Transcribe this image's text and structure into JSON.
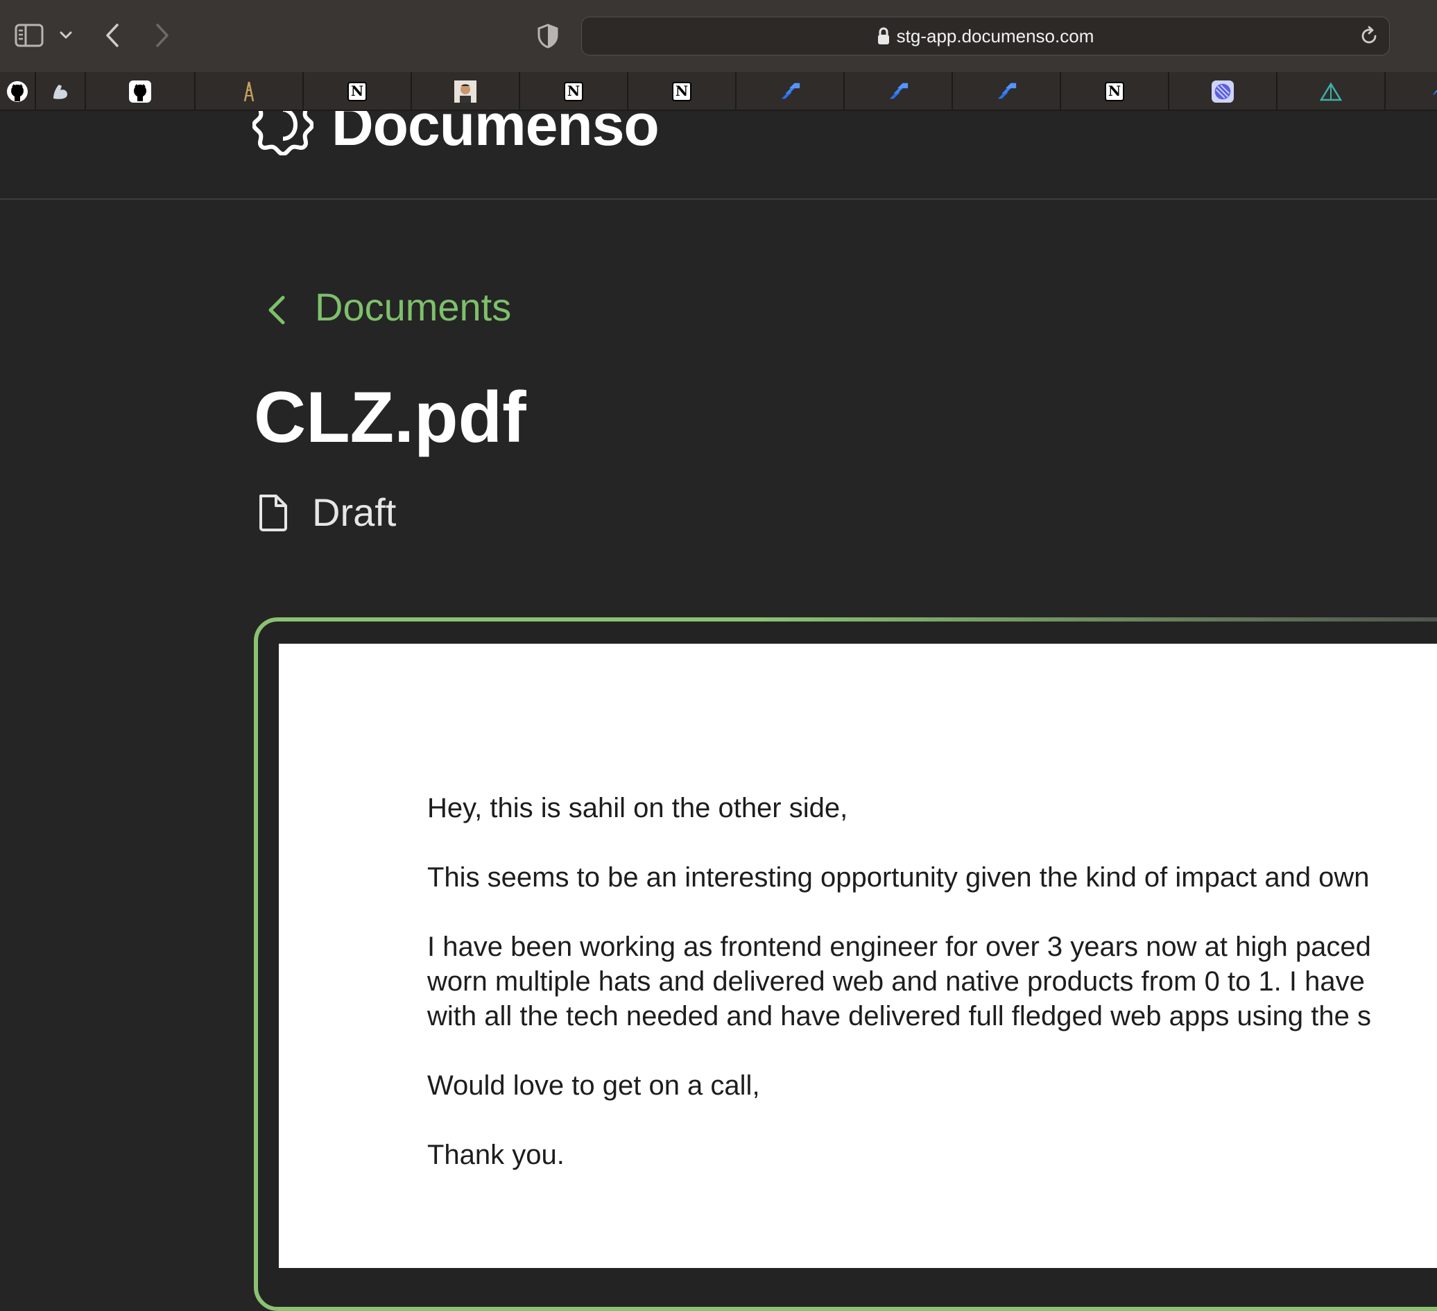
{
  "browser": {
    "url": "stg-app.documenso.com",
    "bookmarks": [
      {
        "icon": "github-icon"
      },
      {
        "icon": "arm-icon"
      },
      {
        "icon": "github-icon"
      },
      {
        "icon": "ladder-icon"
      },
      {
        "icon": "notion-icon"
      },
      {
        "icon": "avatar-icon"
      },
      {
        "icon": "notion-icon"
      },
      {
        "icon": "notion-icon"
      },
      {
        "icon": "jira-icon"
      },
      {
        "icon": "jira-icon"
      },
      {
        "icon": "jira-icon"
      },
      {
        "icon": "notion-icon"
      },
      {
        "icon": "linear-icon"
      },
      {
        "icon": "triangle-icon"
      },
      {
        "icon": "jira-icon"
      }
    ]
  },
  "app": {
    "brand": "Documenso"
  },
  "nav": {
    "back_label": "Documents"
  },
  "document": {
    "title": "CLZ.pdf",
    "status": "Draft",
    "body": [
      "Hey, this is sahil on the other side,",
      "This seems to be an interesting opportunity given the kind of impact and own",
      "I have been working as frontend engineer for over 3 years now at high paced",
      "worn multiple hats and delivered web and native products from 0 to 1. I have",
      "with all the tech needed and have delivered full fledged web apps using the s",
      "Would love to get on a call,",
      "Thank you."
    ]
  },
  "colors": {
    "accent": "#7ec06b",
    "background": "#252525",
    "toolbar": "#3a3634"
  }
}
